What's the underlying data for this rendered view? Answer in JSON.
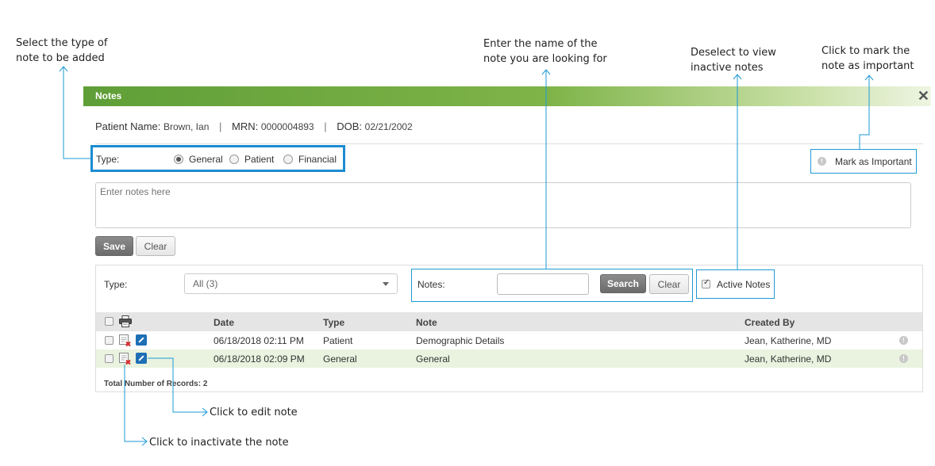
{
  "callouts": {
    "type_note": "Select the type of\nnote to be added",
    "search_name": "Enter the name of the\nnote you are looking for",
    "deselect": "Deselect to view\ninactive notes",
    "important": "Click to mark the\nnote as important",
    "edit": "Click to edit note",
    "inactivate": "Click to inactivate the note"
  },
  "dialog": {
    "title": "Notes",
    "close": "✕"
  },
  "patient": {
    "name_label": "Patient Name:",
    "name": "Brown, Ian",
    "mrn_label": "MRN:",
    "mrn": "0000004893",
    "dob_label": "DOB:",
    "dob": "02/21/2002",
    "sep": "|"
  },
  "entry": {
    "type_label": "Type:",
    "types": [
      "General",
      "Patient",
      "Financial"
    ],
    "selected_type": "General",
    "important_label": "Mark as Important",
    "placeholder": "Enter notes here",
    "save": "Save",
    "clear": "Clear"
  },
  "filter": {
    "type_label": "Type:",
    "type_value": "All (3)",
    "notes_label": "Notes:",
    "search": "Search",
    "clear": "Clear",
    "active_label": "Active Notes",
    "active_checked": true
  },
  "table": {
    "columns": [
      "Date",
      "Type",
      "Note",
      "Created By"
    ],
    "rows": [
      {
        "date": "06/18/2018 02:11 PM",
        "type": "Patient",
        "note": "Demographic Details",
        "created_by": "Jean, Katherine, MD"
      },
      {
        "date": "06/18/2018 02:09 PM",
        "type": "General",
        "note": "General",
        "created_by": "Jean, Katherine, MD"
      }
    ],
    "highlight_color": "#e9f3e0",
    "total_label": "Total Number of Records: 2"
  },
  "colors": {
    "accent": "#1b8cd2",
    "titlebar": "#6aa83c"
  }
}
